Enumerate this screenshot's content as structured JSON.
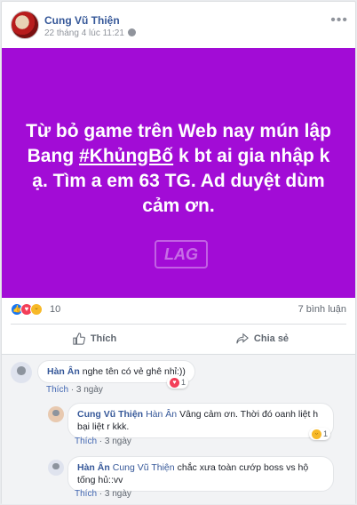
{
  "post": {
    "author": "Cung Vũ Thiện",
    "timestamp": "22 tháng 4 lúc 11:21",
    "text_before": "Từ bỏ game trên Web nay mún lập Bang ",
    "hashtag": "#KhủngBố",
    "text_after": " k bt ai gia nhập k ạ. Tìm a em 63 TG. Ad duyệt dùm cảm ơn.",
    "background": "#a20cd6",
    "watermark": "LAG.vn"
  },
  "stats": {
    "reactions_count": "10",
    "comments_count": "7 bình luận",
    "reaction_icons": [
      "like-icon",
      "love-icon",
      "haha-icon"
    ]
  },
  "actions": {
    "like_label": "Thích",
    "share_label": "Chia sẻ"
  },
  "comments": [
    {
      "name": "Hàn Ân",
      "text": "nghe tên có vẻ ghê nhỉ:))",
      "like_label": "Thích",
      "time": "3 ngày",
      "reaction_count": "1",
      "reaction": "love"
    },
    {
      "name": "Cung Vũ Thiện",
      "tag": "Hàn Ân",
      "text": "Vâng cảm ơn. Thời đó oanh liệt h bại liệt r kkk.",
      "like_label": "Thích",
      "time": "3 ngày",
      "reaction_count": "1",
      "reaction": "haha"
    },
    {
      "name": "Hàn Ân",
      "tag": "Cung Vũ Thiện",
      "text": "chắc xưa toàn cướp boss vs hộ tống hủ::vv",
      "like_label": "Thích",
      "time": "3 ngày"
    }
  ]
}
